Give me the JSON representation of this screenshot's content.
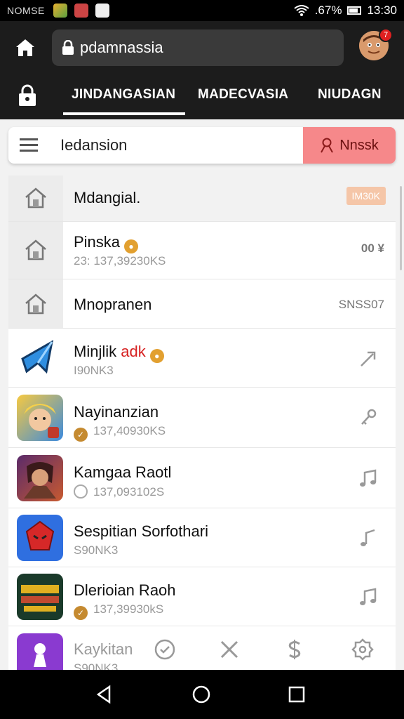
{
  "status_bar": {
    "carrier": "NOMSE",
    "battery_text": ".67%",
    "time": "13:30"
  },
  "browser": {
    "url": "pdamnassia",
    "notification_count": "7"
  },
  "tabs": [
    {
      "label": "JINDANGASIAN",
      "active": true
    },
    {
      "label": "MADECVASIA",
      "active": false
    },
    {
      "label": "NIUDAGN",
      "active": false
    }
  ],
  "search": {
    "label": "Iedansion",
    "action_label": "Nnssk"
  },
  "list": {
    "rows": [
      {
        "title": "Mdangial.",
        "pill": "IM30K"
      },
      {
        "title": "Pinska",
        "subtitle": "23: 137,39230KS",
        "meta": "00 ¥"
      },
      {
        "title": "Mnopranen",
        "meta": "SNSS07"
      },
      {
        "title": "Minjlik",
        "title_accent": "adk",
        "subtitle": "I90NK3"
      },
      {
        "title": "Nayinanzian",
        "subtitle": "137,40930KS"
      },
      {
        "title": "Kamgaa Raotl",
        "subtitle": "137,093102S"
      },
      {
        "title": "Sespitian Sorfothari",
        "subtitle": "S90NK3"
      },
      {
        "title": "Dlerioian Raoh",
        "subtitle": "137,39930kS"
      },
      {
        "title": "Kaykitan",
        "subtitle": "S90NK3"
      }
    ]
  },
  "colors": {
    "accent_button": "#f6888a",
    "pill": "#f5c6a8",
    "price_red": "#c01818",
    "coin": "#e2a030"
  }
}
